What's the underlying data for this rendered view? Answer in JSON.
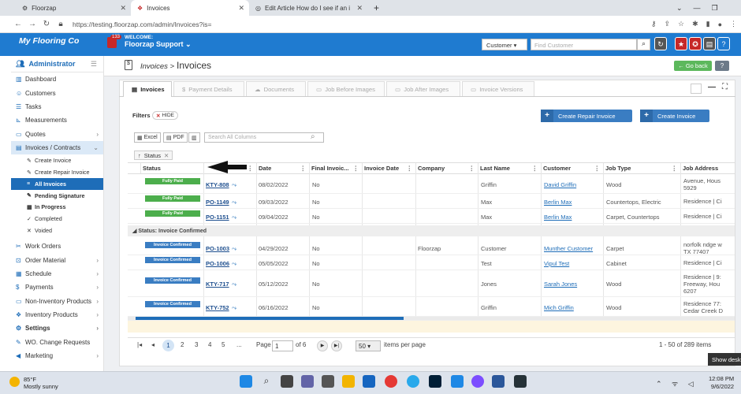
{
  "browser": {
    "tabs": [
      {
        "title": "Floorzap"
      },
      {
        "title": "Invoices"
      },
      {
        "title": "Edit Article How do I see if an inv"
      }
    ],
    "url": "https://testing.floorzap.com/admin/Invoices?is="
  },
  "header": {
    "brand": "My Flooring Co",
    "welcome": "WELCOME:",
    "user": "Floorzap Support",
    "notif_count": "133",
    "search_type": "Customer",
    "search_placeholder": "Find Customer"
  },
  "sidebar": {
    "title": "Administrator",
    "items": [
      {
        "label": "Dashboard",
        "icon": "chart-icon"
      },
      {
        "label": "Customers",
        "icon": "users-icon"
      },
      {
        "label": "Tasks",
        "icon": "tasks-icon"
      },
      {
        "label": "Measurements",
        "icon": "ruler-icon"
      },
      {
        "label": "Quotes",
        "icon": "quote-icon"
      },
      {
        "label": "Invoices / Contracts",
        "icon": "invoice-icon"
      }
    ],
    "subitems": [
      {
        "label": "Create Invoice"
      },
      {
        "label": "Create Repair Invoice"
      },
      {
        "label": "All Invoices"
      },
      {
        "label": "Pending Signature"
      },
      {
        "label": "In Progress"
      },
      {
        "label": "Completed"
      },
      {
        "label": "Voided"
      }
    ],
    "items2": [
      {
        "label": "Work Orders"
      },
      {
        "label": "Order Material"
      },
      {
        "label": "Schedule"
      },
      {
        "label": "Payments"
      },
      {
        "label": "Non-Inventory Products"
      },
      {
        "label": "Inventory Products"
      },
      {
        "label": "Settings"
      },
      {
        "label": "WO. Change Requests"
      },
      {
        "label": "Marketing"
      }
    ]
  },
  "page": {
    "breadcrumb": "Invoices >",
    "title": "Invoices",
    "go_back": "Go back",
    "tabs": [
      "Invoices",
      "Payment Details",
      "Documents",
      "Job Before Images",
      "Job After Images",
      "Invoice Versions"
    ],
    "filters_label": "Filters",
    "hide_label": "HIDE",
    "create_repair": "Create Repair Invoice",
    "create_invoice": "Create Invoice",
    "excel": "Excel",
    "pdf": "PDF",
    "search_placeholder": "Search All Columns",
    "group_chip": "Status"
  },
  "grid": {
    "columns": [
      "Status",
      "",
      "Date",
      "Final Invoic...",
      "Invoice Date",
      "Company",
      "Last Name",
      "Customer",
      "Job Type",
      "Job Address"
    ],
    "group_label": "Status: Invoice Confirmed",
    "rows": [
      {
        "status": "Fully Paid",
        "num": "KTY-808",
        "date": "08/02/2022",
        "final": "No",
        "company": "",
        "last": "Griffin",
        "customer": "David Griffin",
        "job": "Wood",
        "addr1": "Avenue, Hous",
        "addr2": "5929"
      },
      {
        "status": "Fully Paid",
        "num": "PO-1149",
        "date": "09/03/2022",
        "final": "No",
        "company": "",
        "last": "Max",
        "customer": "Berlin Max",
        "job": "Countertops, Electric",
        "addr1": "Residence | Ci",
        "addr2": ""
      },
      {
        "status": "Fully Paid",
        "num": "PO-1151",
        "date": "09/04/2022",
        "final": "No",
        "company": "",
        "last": "Max",
        "customer": "Berlin Max",
        "job": "Carpet, Countertops",
        "addr1": "Residence | Ci",
        "addr2": ""
      },
      {
        "status": "Invoice Confirmed",
        "num": "PO-1003",
        "date": "04/29/2022",
        "final": "No",
        "company": "Floorzap",
        "last": "Customer",
        "customer": "Munther Customer",
        "job": "Carpet",
        "addr1": "norfolk ndge w",
        "addr2": "TX 77407"
      },
      {
        "status": "Invoice Confirmed",
        "num": "PO-1006",
        "date": "05/05/2022",
        "final": "No",
        "company": "",
        "last": "Test",
        "customer": "Vipul Test",
        "job": "Cabinet",
        "addr1": "Residence | Ci",
        "addr2": ""
      },
      {
        "status": "Invoice Confirmed",
        "num": "KTY-717",
        "date": "05/12/2022",
        "final": "No",
        "company": "",
        "last": "Jones",
        "customer": "Sarah Jones",
        "job": "Wood",
        "addr1": "Residence | 9:",
        "addr2": "Freeway, Hou",
        "addr3": "6207"
      },
      {
        "status": "Invoice Confirmed",
        "num": "KTY-752",
        "date": "06/16/2022",
        "final": "No",
        "company": "",
        "last": "Griffin",
        "customer": "Mich Griffin",
        "job": "Wood",
        "addr1": "Residence 77:",
        "addr2": "Cedar Creek D"
      }
    ]
  },
  "pager": {
    "pages": [
      "1",
      "2",
      "3",
      "4",
      "5",
      "..."
    ],
    "page_label": "Page",
    "page_value": "1",
    "of": "of 6",
    "per_page": "50",
    "per_page_label": "items per page",
    "range": "1 - 50 of 289 items"
  },
  "taskbar": {
    "temp": "85°F",
    "weather": "Mostly sunny",
    "time": "12:08 PM",
    "date": "9/6/2022",
    "tooltip": "Show deskt"
  },
  "colors": {
    "brand": "#1f7bd0",
    "paid": "#4cae4c",
    "confirmed": "#3a7dc2"
  }
}
